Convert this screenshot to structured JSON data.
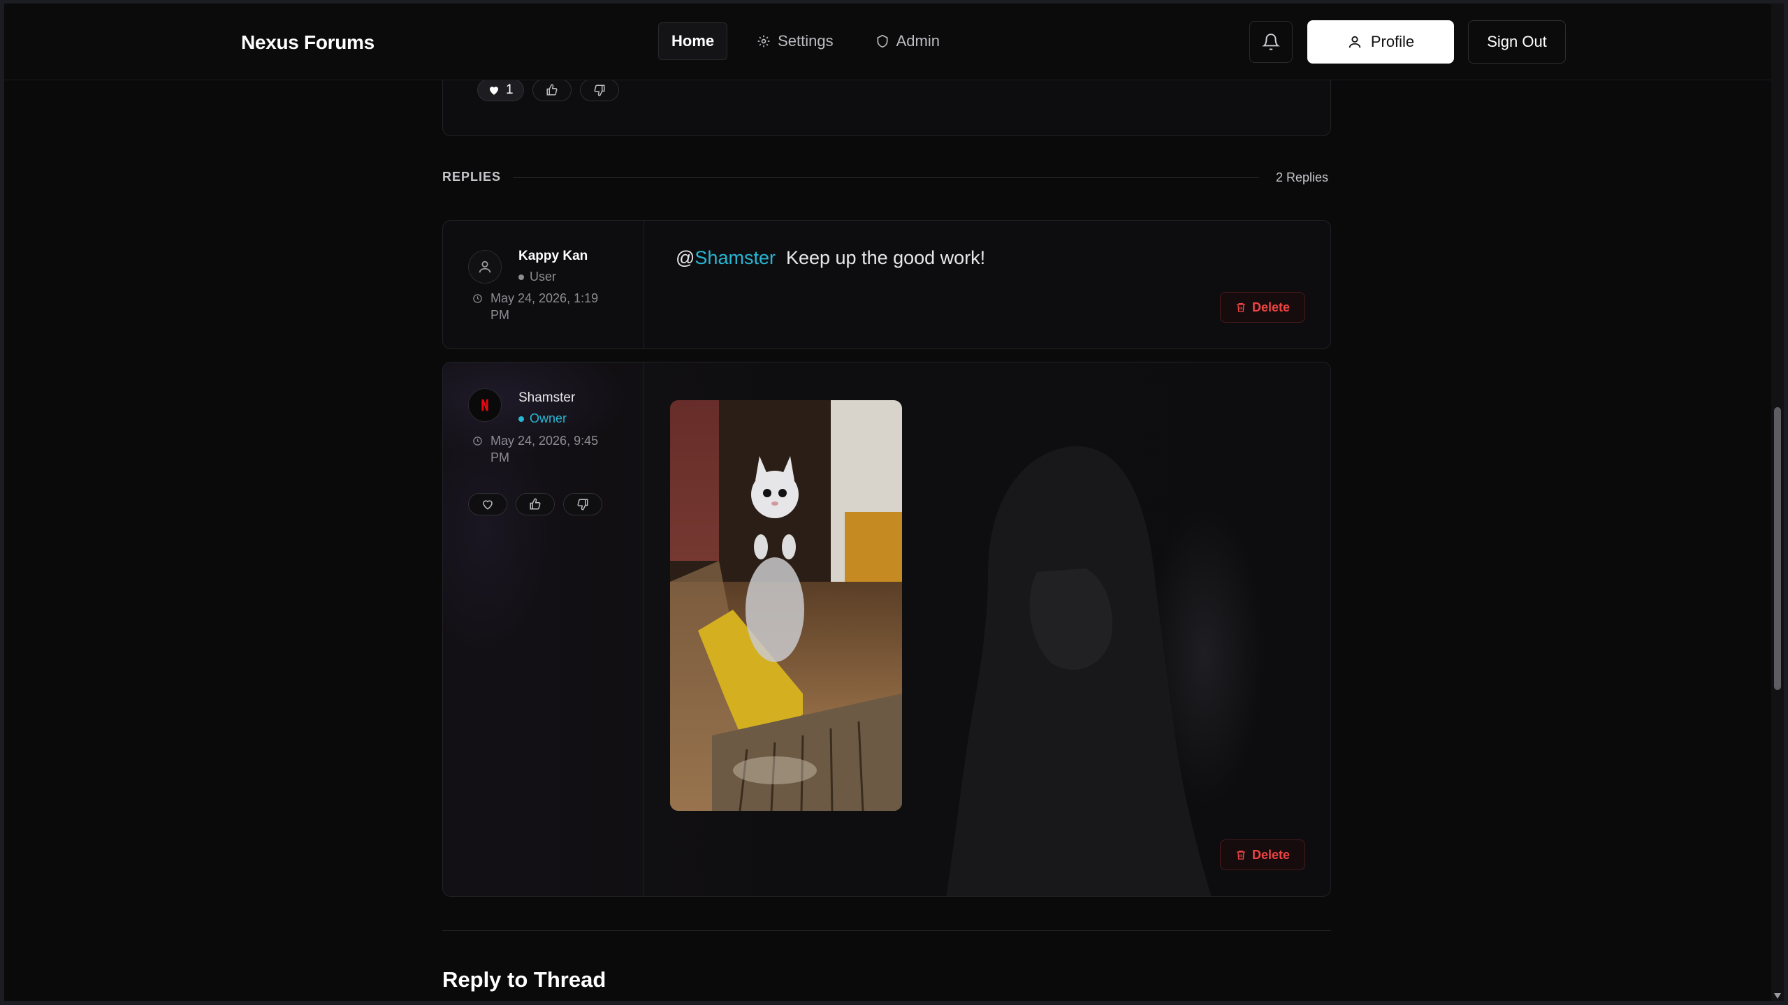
{
  "header": {
    "brand": "Nexus Forums",
    "nav": [
      {
        "label": "Home",
        "icon": "home",
        "active": true
      },
      {
        "label": "Settings",
        "icon": "gear-icon",
        "active": false
      },
      {
        "label": "Admin",
        "icon": "shield-icon",
        "active": false
      }
    ],
    "profile_label": "Profile",
    "signout_label": "Sign Out"
  },
  "post": {
    "heart_count": "1"
  },
  "replies": {
    "label": "REPLIES",
    "count_label": "2 Replies",
    "items": [
      {
        "author": "Kappy Kan",
        "role": "User",
        "role_color": "#8c8c93",
        "timestamp": "May 24, 2026, 1:19 PM",
        "mention_at": "@",
        "mention_name": "Shamster",
        "message": "Keep up the good work!",
        "delete_label": "Delete"
      },
      {
        "author": "Shamster",
        "role": "Owner",
        "role_color": "#29b6d4",
        "timestamp": "May 24, 2026, 9:45 PM",
        "delete_label": "Delete"
      }
    ]
  },
  "composer": {
    "title": "Reply to Thread"
  },
  "colors": {
    "accent": "#29b6d4",
    "danger": "#ef4444",
    "background": "#0a0a0b"
  }
}
